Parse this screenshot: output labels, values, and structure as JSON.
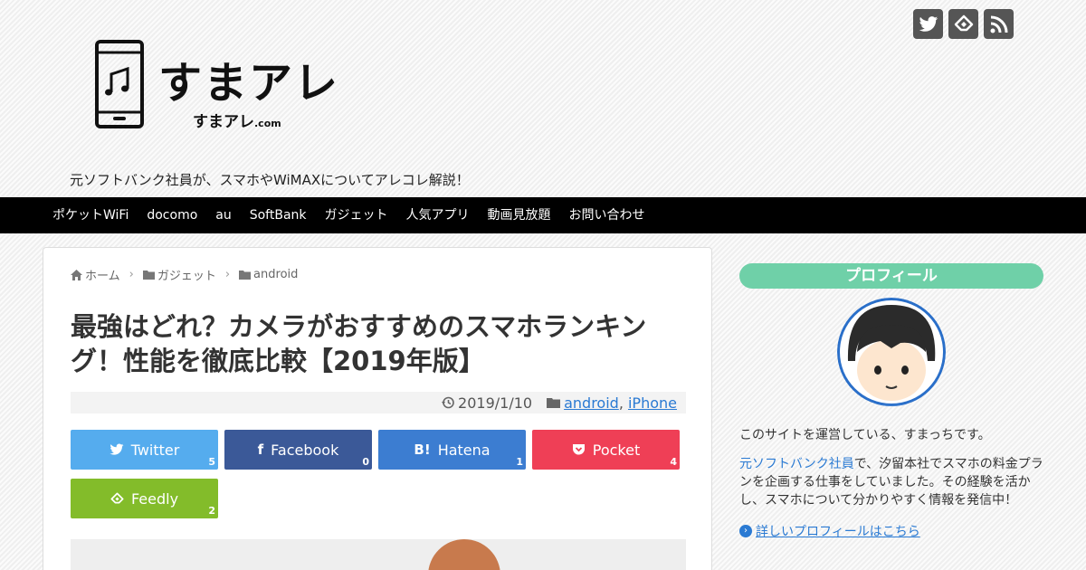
{
  "site": {
    "logo_title": "すまアレ",
    "logo_sub": "すまアレ",
    "logo_sub_small": ".com",
    "tagline": "元ソフトバンク社員が、スマホやWiMAXについてアレコレ解説！"
  },
  "social": [
    {
      "icon": "twitter-icon"
    },
    {
      "icon": "feedly-icon"
    },
    {
      "icon": "rss-icon"
    }
  ],
  "nav": [
    "ポケットWiFi",
    "docomo",
    "au",
    "SoftBank",
    "ガジェット",
    "人気アプリ",
    "動画見放題",
    "お問い合わせ"
  ],
  "breadcrumb": [
    "ホーム",
    "ガジェット",
    "android"
  ],
  "article": {
    "title": "最強はどれ？カメラがおすすめのスマホランキング！性能を徹底比較【2019年版】",
    "date": "2019/1/10",
    "categories": [
      "android",
      "iPhone"
    ],
    "category_sep": ", "
  },
  "share": {
    "twitter": {
      "label": "Twitter",
      "count": "5",
      "color": "#55acee"
    },
    "facebook": {
      "label": "Facebook",
      "count": "0",
      "color": "#3b5998"
    },
    "hatena": {
      "label": "Hatena",
      "count": "1",
      "color": "#3c7dd1"
    },
    "pocket": {
      "label": "Pocket",
      "count": "4",
      "color": "#ef3f56"
    },
    "feedly": {
      "label": "Feedly",
      "count": "2",
      "color": "#83bc2a"
    }
  },
  "sidebar": {
    "heading": "プロフィール",
    "intro": "このサイトを運営している、すまっちです。",
    "bio_link": "元ソフトバンク社員",
    "bio_rest": "で、汐留本社でスマホの料金プランを企画する仕事をしていました。その経験を活かし、スマホについて分かりやすく情報を発信中！",
    "more_link": "詳しいプロフィールはこちら"
  }
}
